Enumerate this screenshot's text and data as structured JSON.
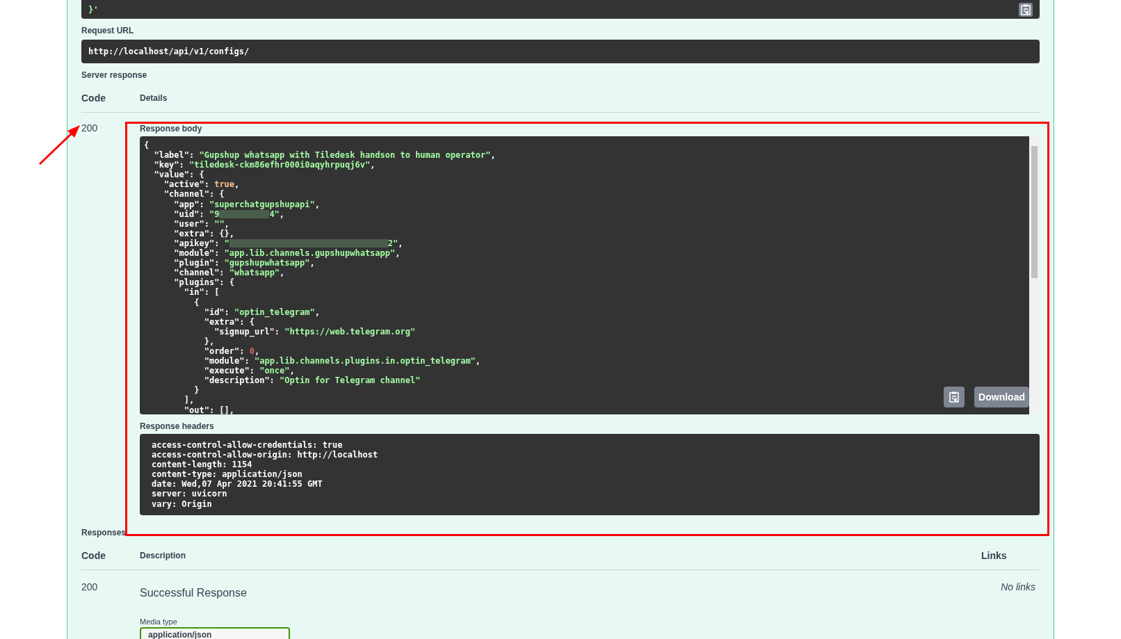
{
  "request_body_tail": "}'",
  "request_url": {
    "label": "Request URL",
    "value": "http://localhost/api/v1/configs/"
  },
  "server_response": {
    "label": "Server response",
    "columns": [
      "Code",
      "Details"
    ],
    "code": "200",
    "body_label": "Response body",
    "body_lines": [
      [
        {
          "kind": "punct",
          "text": "{"
        }
      ],
      [
        {
          "kind": "punct",
          "text": "  \"label\": "
        },
        {
          "kind": "string",
          "text": "\"Gupshup whatsapp with Tiledesk handson to human operator\""
        },
        {
          "kind": "punct",
          "text": ","
        }
      ],
      [
        {
          "kind": "punct",
          "text": "  \"key\": "
        },
        {
          "kind": "string",
          "text": "\"tiledesk-ckm86efhr000i0aqyhrpuqj6v\""
        },
        {
          "kind": "punct",
          "text": ","
        }
      ],
      [
        {
          "kind": "punct",
          "text": "  \"value\": {"
        }
      ],
      [
        {
          "kind": "punct",
          "text": "    \"active\": "
        },
        {
          "kind": "bool",
          "text": "true"
        },
        {
          "kind": "punct",
          "text": ","
        }
      ],
      [
        {
          "kind": "punct",
          "text": "    \"channel\": {"
        }
      ],
      [
        {
          "kind": "punct",
          "text": "      \"app\": "
        },
        {
          "kind": "string",
          "text": "\"superchatgupshupapi\""
        },
        {
          "kind": "punct",
          "text": ","
        }
      ],
      [
        {
          "kind": "punct",
          "text": "      \"uid\": "
        },
        {
          "kind": "string",
          "text": "\"9"
        },
        {
          "kind": "redacted",
          "wide": false
        },
        {
          "kind": "string",
          "text": "4\""
        },
        {
          "kind": "punct",
          "text": ","
        }
      ],
      [
        {
          "kind": "punct",
          "text": "      \"user\": "
        },
        {
          "kind": "string",
          "text": "\"\""
        },
        {
          "kind": "punct",
          "text": ","
        }
      ],
      [
        {
          "kind": "punct",
          "text": "      \"extra\": {},"
        }
      ],
      [
        {
          "kind": "punct",
          "text": "      \"apikey\": "
        },
        {
          "kind": "string",
          "text": "\""
        },
        {
          "kind": "redacted",
          "wide": true
        },
        {
          "kind": "string",
          "text": "2\""
        },
        {
          "kind": "punct",
          "text": ","
        }
      ],
      [
        {
          "kind": "punct",
          "text": "      \"module\": "
        },
        {
          "kind": "string",
          "text": "\"app.lib.channels.gupshupwhatsapp\""
        },
        {
          "kind": "punct",
          "text": ","
        }
      ],
      [
        {
          "kind": "punct",
          "text": "      \"plugin\": "
        },
        {
          "kind": "string",
          "text": "\"gupshupwhatsapp\""
        },
        {
          "kind": "punct",
          "text": ","
        }
      ],
      [
        {
          "kind": "punct",
          "text": "      \"channel\": "
        },
        {
          "kind": "string",
          "text": "\"whatsapp\""
        },
        {
          "kind": "punct",
          "text": ","
        }
      ],
      [
        {
          "kind": "punct",
          "text": "      \"plugins\": {"
        }
      ],
      [
        {
          "kind": "punct",
          "text": "        \"in\": ["
        }
      ],
      [
        {
          "kind": "punct",
          "text": "          {"
        }
      ],
      [
        {
          "kind": "punct",
          "text": "            \"id\": "
        },
        {
          "kind": "string",
          "text": "\"optin_telegram\""
        },
        {
          "kind": "punct",
          "text": ","
        }
      ],
      [
        {
          "kind": "punct",
          "text": "            \"extra\": {"
        }
      ],
      [
        {
          "kind": "punct",
          "text": "              \"signup_url\": "
        },
        {
          "kind": "string",
          "text": "\"https://web.telegram.org\""
        }
      ],
      [
        {
          "kind": "punct",
          "text": "            },"
        }
      ],
      [
        {
          "kind": "punct",
          "text": "            \"order\": "
        },
        {
          "kind": "number",
          "text": "0"
        },
        {
          "kind": "punct",
          "text": ","
        }
      ],
      [
        {
          "kind": "punct",
          "text": "            \"module\": "
        },
        {
          "kind": "string",
          "text": "\"app.lib.channels.plugins.in.optin_telegram\""
        },
        {
          "kind": "punct",
          "text": ","
        }
      ],
      [
        {
          "kind": "punct",
          "text": "            \"execute\": "
        },
        {
          "kind": "string",
          "text": "\"once\""
        },
        {
          "kind": "punct",
          "text": ","
        }
      ],
      [
        {
          "kind": "punct",
          "text": "            \"description\": "
        },
        {
          "kind": "string",
          "text": "\"Optin for Telegram channel\""
        }
      ],
      [
        {
          "kind": "punct",
          "text": "          }"
        }
      ],
      [
        {
          "kind": "punct",
          "text": "        ],"
        }
      ],
      [
        {
          "kind": "punct",
          "text": "        \"out\": [],"
        }
      ]
    ],
    "download_label": "Download",
    "headers_label": "Response headers",
    "header_lines": [
      "access-control-allow-credentials: true",
      "access-control-allow-origin: http://localhost",
      "content-length: 1154",
      "content-type: application/json",
      "date: Wed,07 Apr 2021 20:41:55 GMT",
      "server: uvicorn",
      "vary: Origin"
    ]
  },
  "responses": {
    "label": "Responses",
    "columns": [
      "Code",
      "Description",
      "Links"
    ],
    "rows": [
      {
        "code": "200",
        "description": "Successful Response",
        "links": "No links",
        "media_type_label": "Media type",
        "media_type": "application/json"
      }
    ]
  }
}
